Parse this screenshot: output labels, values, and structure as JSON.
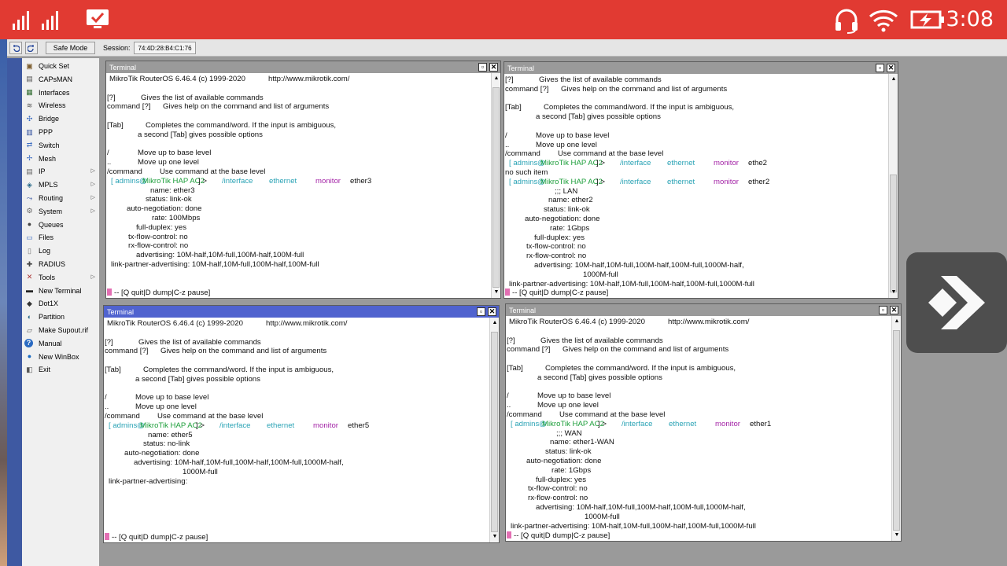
{
  "status_bar": {
    "time": "3:08"
  },
  "toolbar": {
    "safe_mode": "Safe Mode",
    "session_label": "Session:",
    "session_value": "74:4D:28:B4:C1:76"
  },
  "sidebar": {
    "items": [
      {
        "label": "Quick Set",
        "icon": "quickset-icon",
        "submenu": false
      },
      {
        "label": "CAPsMAN",
        "icon": "capsman-icon",
        "submenu": false
      },
      {
        "label": "Interfaces",
        "icon": "interfaces-icon",
        "submenu": false
      },
      {
        "label": "Wireless",
        "icon": "wireless-icon",
        "submenu": false
      },
      {
        "label": "Bridge",
        "icon": "bridge-icon",
        "submenu": false
      },
      {
        "label": "PPP",
        "icon": "ppp-icon",
        "submenu": false
      },
      {
        "label": "Switch",
        "icon": "switch-icon",
        "submenu": false
      },
      {
        "label": "Mesh",
        "icon": "mesh-icon",
        "submenu": false
      },
      {
        "label": "IP",
        "icon": "ip-icon",
        "submenu": true
      },
      {
        "label": "MPLS",
        "icon": "mpls-icon",
        "submenu": true
      },
      {
        "label": "Routing",
        "icon": "routing-icon",
        "submenu": true
      },
      {
        "label": "System",
        "icon": "system-icon",
        "submenu": true
      },
      {
        "label": "Queues",
        "icon": "queues-icon",
        "submenu": false
      },
      {
        "label": "Files",
        "icon": "files-icon",
        "submenu": false
      },
      {
        "label": "Log",
        "icon": "log-icon",
        "submenu": false
      },
      {
        "label": "RADIUS",
        "icon": "radius-icon",
        "submenu": false
      },
      {
        "label": "Tools",
        "icon": "tools-icon",
        "submenu": true
      },
      {
        "label": "New Terminal",
        "icon": "terminal-icon",
        "submenu": false
      },
      {
        "label": "Dot1X",
        "icon": "dot1x-icon",
        "submenu": false
      },
      {
        "label": "Partition",
        "icon": "partition-icon",
        "submenu": false
      },
      {
        "label": "Make Supout.rif",
        "icon": "supout-icon",
        "submenu": false
      },
      {
        "label": "Manual",
        "icon": "manual-icon",
        "submenu": false
      },
      {
        "label": "New WinBox",
        "icon": "winbox-icon",
        "submenu": false
      },
      {
        "label": "Exit",
        "icon": "exit-icon",
        "submenu": false
      }
    ]
  },
  "terminals": [
    {
      "title": "Terminal",
      "lines": [
        [
          {
            "t": "MikroTik RouterOS 6.46.4 (c) 1999-2020"
          },
          {
            "t": "http://www.mikrotik.com/"
          }
        ],
        [],
        [
          {
            "t": "[?]"
          },
          {
            "t": "Gives the list of available commands"
          }
        ],
        [
          {
            "t": "command [?]"
          },
          {
            "t": "Gives help on the command and list of arguments"
          }
        ],
        [],
        [
          {
            "t": "[Tab]"
          },
          {
            "t": "Completes the command/word. If the input is ambiguous,"
          }
        ],
        [
          {
            "t": "a second [Tab] gives possible options"
          }
        ],
        [],
        [
          {
            "t": "/"
          },
          {
            "t": "Move up to base level"
          }
        ],
        [
          {
            "t": ".."
          },
          {
            "t": "Move up one level"
          }
        ],
        [
          {
            "t": "/command"
          },
          {
            "t": "Use command at the base level"
          }
        ],
        [
          {
            "t": "[ admins",
            "c": "user"
          },
          {
            "t": "@",
            "c": "user"
          },
          {
            "t": "MikroTik HAP AC2",
            "c": "host"
          },
          {
            "t": "] >"
          },
          {
            "t": "/interface",
            "c": "path"
          },
          {
            "t": "ethernet",
            "c": "path"
          },
          {
            "t": "monitor",
            "c": "cmd"
          },
          {
            "t": "ether3"
          }
        ],
        [
          {
            "t": "name: ether3"
          }
        ],
        [
          {
            "t": "status: link-ok"
          }
        ],
        [
          {
            "t": "auto-negotiation: done"
          }
        ],
        [
          {
            "t": "rate: 100Mbps"
          }
        ],
        [
          {
            "t": "full-duplex: yes"
          }
        ],
        [
          {
            "t": "tx-flow-control: no"
          }
        ],
        [
          {
            "t": "rx-flow-control: no"
          }
        ],
        [
          {
            "t": "advertising: 10M-half,10M-full,100M-half,100M-full"
          }
        ],
        [
          {
            "t": "link-partner-advertising: 10M-half,10M-full,100M-half,100M-full"
          }
        ]
      ],
      "footer": "-- [Q quit|D dump|C-z pause]"
    },
    {
      "title": "Terminal",
      "lines": [
        [
          {
            "t": "[?]"
          },
          {
            "t": "Gives the list of available commands"
          }
        ],
        [
          {
            "t": "command [?]"
          },
          {
            "t": "Gives help on the command and list of arguments"
          }
        ],
        [],
        [
          {
            "t": "[Tab]"
          },
          {
            "t": "Completes the command/word. If the input is ambiguous,"
          }
        ],
        [
          {
            "t": "a second [Tab] gives possible options"
          }
        ],
        [],
        [
          {
            "t": "/"
          },
          {
            "t": "Move up to base level"
          }
        ],
        [
          {
            "t": ".."
          },
          {
            "t": "Move up one level"
          }
        ],
        [
          {
            "t": "/command"
          },
          {
            "t": "Use command at the base level"
          }
        ],
        [
          {
            "t": "[ admins",
            "c": "user"
          },
          {
            "t": "@",
            "c": "user"
          },
          {
            "t": "MikroTik HAP AC2",
            "c": "host"
          },
          {
            "t": "] >"
          },
          {
            "t": "/interface",
            "c": "path"
          },
          {
            "t": "ethernet",
            "c": "path"
          },
          {
            "t": "monitor",
            "c": "cmd"
          },
          {
            "t": "ethe2"
          }
        ],
        [
          {
            "t": "no such item"
          }
        ],
        [
          {
            "t": "[ admins",
            "c": "user"
          },
          {
            "t": "@",
            "c": "user"
          },
          {
            "t": "MikroTik HAP AC2",
            "c": "host"
          },
          {
            "t": "] >"
          },
          {
            "t": "/interface",
            "c": "path"
          },
          {
            "t": "ethernet",
            "c": "path"
          },
          {
            "t": "monitor",
            "c": "cmd"
          },
          {
            "t": "ether2"
          }
        ],
        [
          {
            "t": ";;; LAN"
          }
        ],
        [
          {
            "t": "name: ether2"
          }
        ],
        [
          {
            "t": "status: link-ok"
          }
        ],
        [
          {
            "t": "auto-negotiation: done"
          }
        ],
        [
          {
            "t": "rate: 1Gbps"
          }
        ],
        [
          {
            "t": "full-duplex: yes"
          }
        ],
        [
          {
            "t": "tx-flow-control: no"
          }
        ],
        [
          {
            "t": "rx-flow-control: no"
          }
        ],
        [
          {
            "t": "advertising: 10M-half,10M-full,100M-half,100M-full,1000M-half,"
          }
        ],
        [
          {
            "t": "1000M-full"
          }
        ],
        [
          {
            "t": "link-partner-advertising: 10M-half,10M-full,100M-half,100M-full,1000M-full"
          }
        ]
      ],
      "footer": "-- [Q quit|D dump|C-z pause]"
    },
    {
      "title": "Terminal",
      "lines": [
        [
          {
            "t": "MikroTik RouterOS 6.46.4 (c) 1999-2020"
          },
          {
            "t": "http://www.mikrotik.com/"
          }
        ],
        [],
        [
          {
            "t": "[?]"
          },
          {
            "t": "Gives the list of available commands"
          }
        ],
        [
          {
            "t": "command [?]"
          },
          {
            "t": "Gives help on the command and list of arguments"
          }
        ],
        [],
        [
          {
            "t": "[Tab]"
          },
          {
            "t": "Completes the command/word. If the input is ambiguous,"
          }
        ],
        [
          {
            "t": "a second [Tab] gives possible options"
          }
        ],
        [],
        [
          {
            "t": "/"
          },
          {
            "t": "Move up to base level"
          }
        ],
        [
          {
            "t": ".."
          },
          {
            "t": "Move up one level"
          }
        ],
        [
          {
            "t": "/command"
          },
          {
            "t": "Use command at the base level"
          }
        ],
        [
          {
            "t": "[ admins",
            "c": "user"
          },
          {
            "t": "@",
            "c": "user"
          },
          {
            "t": "MikroTik HAP AC2",
            "c": "host"
          },
          {
            "t": "] >"
          },
          {
            "t": "/interface",
            "c": "path"
          },
          {
            "t": "ethernet",
            "c": "path"
          },
          {
            "t": "monitor",
            "c": "cmd"
          },
          {
            "t": "ether5"
          }
        ],
        [
          {
            "t": "name: ether5"
          }
        ],
        [
          {
            "t": "status: no-link"
          }
        ],
        [
          {
            "t": "auto-negotiation: done"
          }
        ],
        [
          {
            "t": "advertising: 10M-half,10M-full,100M-half,100M-full,1000M-half,"
          }
        ],
        [
          {
            "t": "1000M-full"
          }
        ],
        [
          {
            "t": "link-partner-advertising:"
          }
        ]
      ],
      "footer": "-- [Q quit|D dump|C-z pause]"
    },
    {
      "title": "Terminal",
      "lines": [
        [
          {
            "t": "MikroTik RouterOS 6.46.4 (c) 1999-2020"
          },
          {
            "t": "http://www.mikrotik.com/"
          }
        ],
        [],
        [
          {
            "t": "[?]"
          },
          {
            "t": "Gives the list of available commands"
          }
        ],
        [
          {
            "t": "command [?]"
          },
          {
            "t": "Gives help on the command and list of arguments"
          }
        ],
        [],
        [
          {
            "t": "[Tab]"
          },
          {
            "t": "Completes the command/word. If the input is ambiguous,"
          }
        ],
        [
          {
            "t": "a second [Tab] gives possible options"
          }
        ],
        [],
        [
          {
            "t": "/"
          },
          {
            "t": "Move up to base level"
          }
        ],
        [
          {
            "t": ".."
          },
          {
            "t": "Move up one level"
          }
        ],
        [
          {
            "t": "/command"
          },
          {
            "t": "Use command at the base level"
          }
        ],
        [
          {
            "t": "[ admins",
            "c": "user"
          },
          {
            "t": "@",
            "c": "user"
          },
          {
            "t": "MikroTik HAP AC2",
            "c": "host"
          },
          {
            "t": "] >"
          },
          {
            "t": "/interface",
            "c": "path"
          },
          {
            "t": "ethernet",
            "c": "path"
          },
          {
            "t": "monitor",
            "c": "cmd"
          },
          {
            "t": "ether1"
          }
        ],
        [
          {
            "t": ";;; WAN"
          }
        ],
        [
          {
            "t": "name: ether1-WAN"
          }
        ],
        [
          {
            "t": "status: link-ok"
          }
        ],
        [
          {
            "t": "auto-negotiation: done"
          }
        ],
        [
          {
            "t": "rate: 1Gbps"
          }
        ],
        [
          {
            "t": "full-duplex: yes"
          }
        ],
        [
          {
            "t": "tx-flow-control: no"
          }
        ],
        [
          {
            "t": "rx-flow-control: no"
          }
        ],
        [
          {
            "t": "advertising: 10M-half,10M-full,100M-half,100M-full,1000M-half,"
          }
        ],
        [
          {
            "t": "1000M-full"
          }
        ],
        [
          {
            "t": "link-partner-advertising: 10M-half,10M-full,100M-half,100M-full,1000M-full"
          }
        ]
      ],
      "footer": "-- [Q quit|D dump|C-z pause]"
    }
  ]
}
